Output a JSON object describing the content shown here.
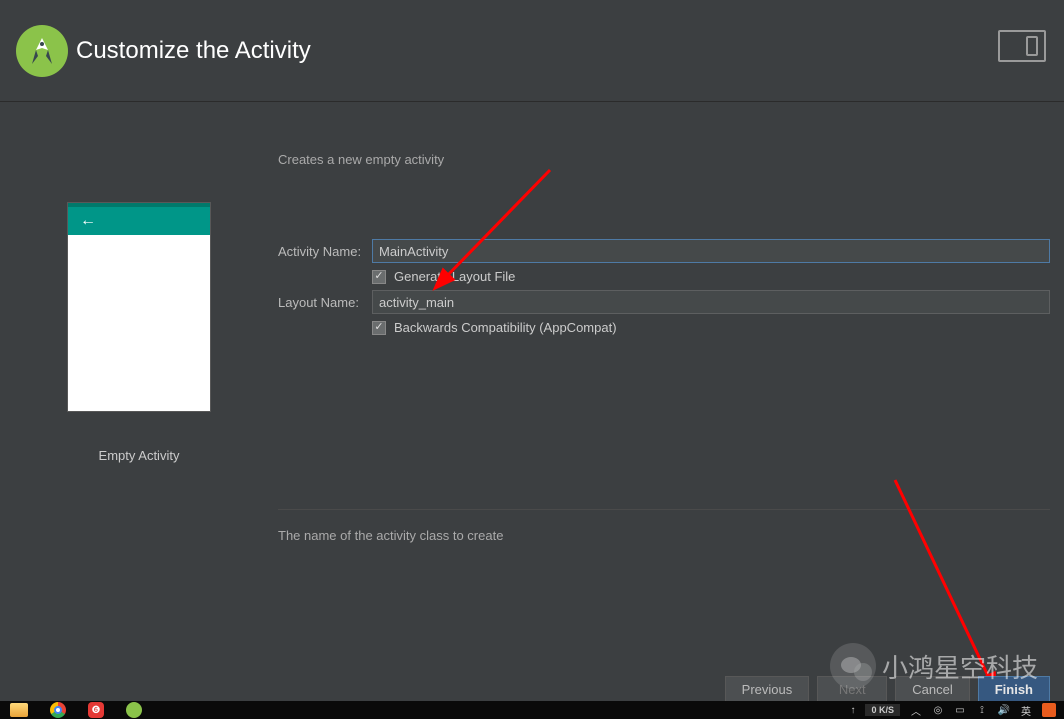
{
  "header": {
    "title": "Customize the Activity"
  },
  "preview": {
    "label": "Empty Activity"
  },
  "form": {
    "intro": "Creates a new empty activity",
    "activity_name_label": "Activity Name:",
    "activity_name_value": "MainActivity",
    "generate_layout_label": "Generate Layout File",
    "layout_name_label": "Layout Name:",
    "layout_name_value": "activity_main",
    "backwards_compat_label": "Backwards Compatibility (AppCompat)",
    "help_text": "The name of the activity class to create"
  },
  "buttons": {
    "previous": "Previous",
    "next": "Next",
    "cancel": "Cancel",
    "finish": "Finish"
  },
  "taskbar": {
    "net_speed": "0 K/S",
    "lang": "英"
  },
  "watermark": {
    "text": "小鸿星空科技"
  }
}
